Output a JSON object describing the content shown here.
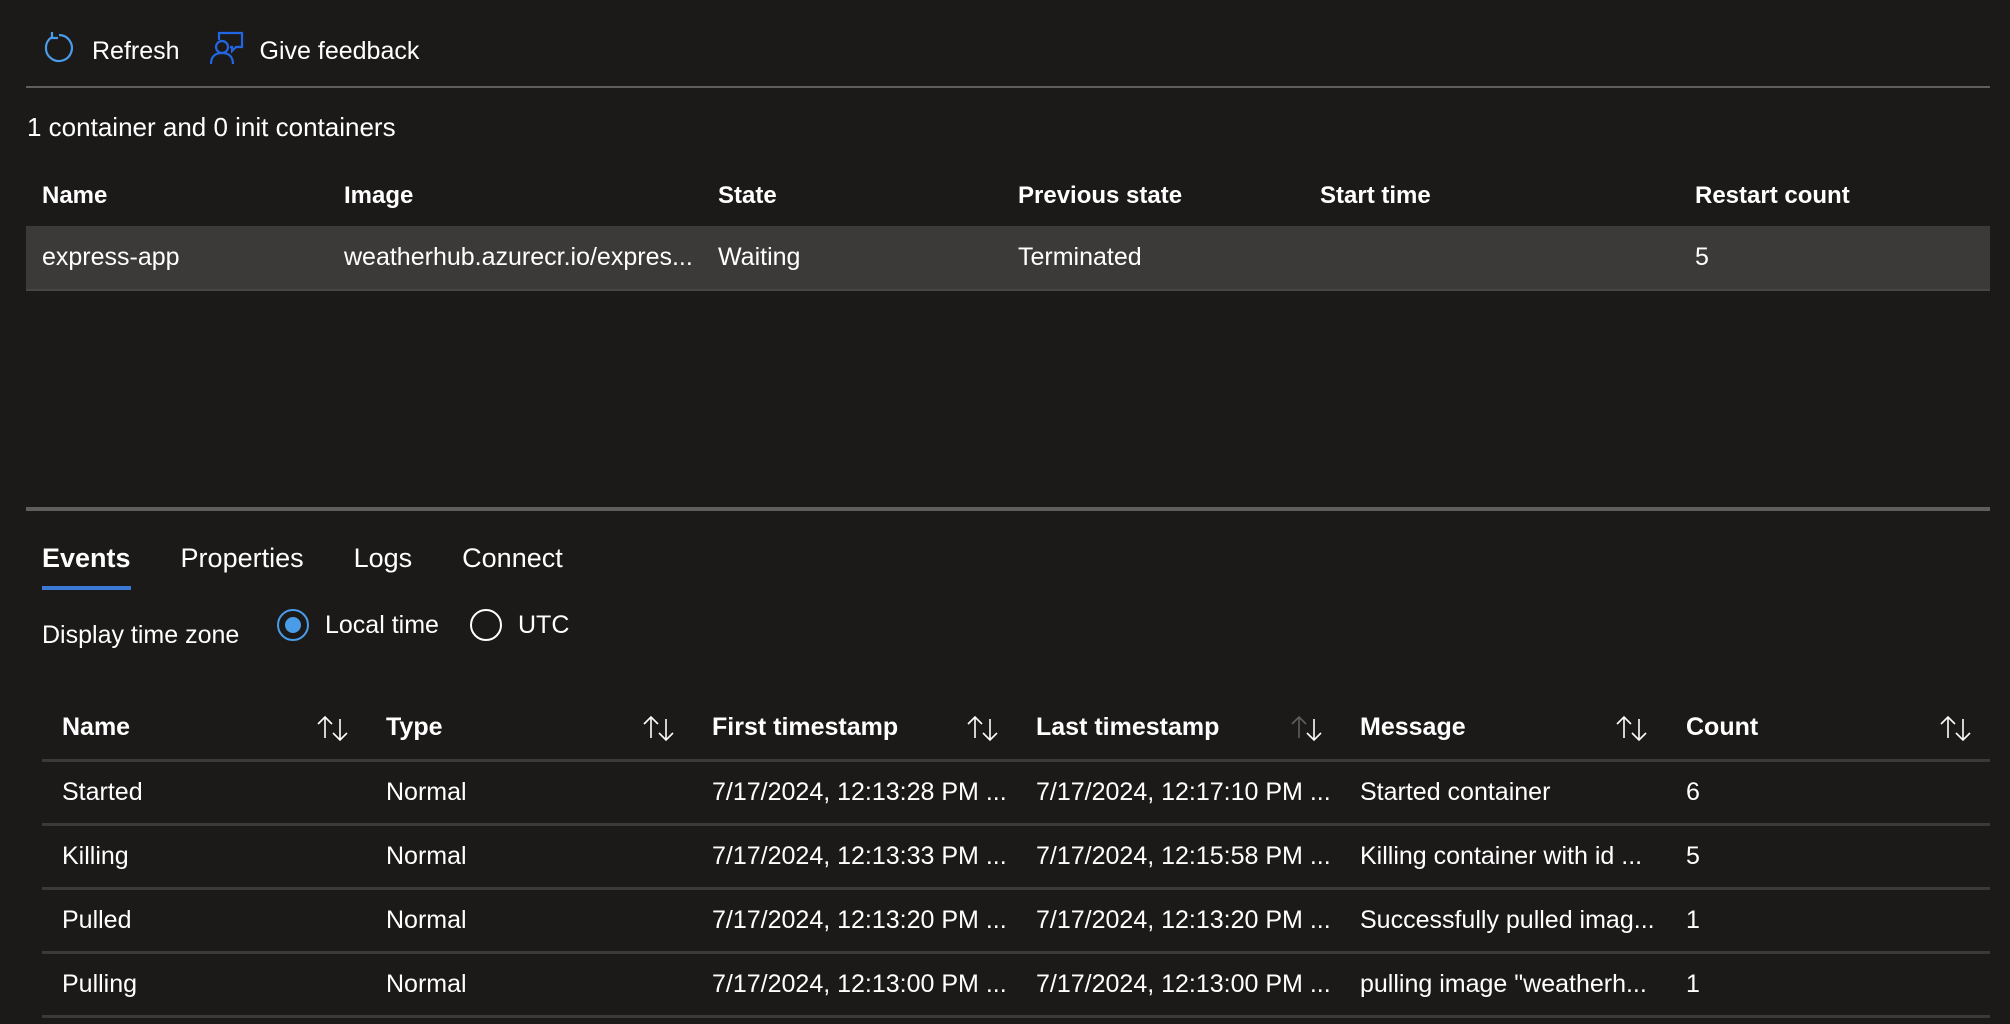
{
  "toolbar": {
    "refresh_label": "Refresh",
    "feedback_label": "Give feedback",
    "icon_refresh": "refresh-icon",
    "icon_feedback": "feedback-icon",
    "accent_refresh": "#4a9ce8",
    "accent_feedback": "#2266e3"
  },
  "containers": {
    "summary": "1 container and 0 init containers",
    "columns": [
      "Name",
      "Image",
      "State",
      "Previous state",
      "Start time",
      "Restart count"
    ],
    "rows": [
      {
        "name": "express-app",
        "image": "weatherhub.azurecr.io/expres...",
        "state": "Waiting",
        "previous_state": "Terminated",
        "start_time": "",
        "restart_count": "5"
      }
    ]
  },
  "tabs": [
    {
      "label": "Events",
      "active": true
    },
    {
      "label": "Properties",
      "active": false
    },
    {
      "label": "Logs",
      "active": false
    },
    {
      "label": "Connect",
      "active": false
    }
  ],
  "timezone": {
    "label": "Display time zone",
    "options": [
      {
        "label": "Local time",
        "checked": true
      },
      {
        "label": "UTC",
        "checked": false
      }
    ]
  },
  "events": {
    "columns": [
      {
        "label": "Name",
        "sort": "none"
      },
      {
        "label": "Type",
        "sort": "none"
      },
      {
        "label": "First timestamp",
        "sort": "none"
      },
      {
        "label": "Last timestamp",
        "sort": "descending"
      },
      {
        "label": "Message",
        "sort": "none"
      },
      {
        "label": "Count",
        "sort": "none"
      }
    ],
    "rows": [
      {
        "name": "Started",
        "type": "Normal",
        "first": "7/17/2024, 12:13:28 PM ...",
        "last": "7/17/2024, 12:17:10 PM ...",
        "message": "Started container",
        "count": "6"
      },
      {
        "name": "Killing",
        "type": "Normal",
        "first": "7/17/2024, 12:13:33 PM ...",
        "last": "7/17/2024, 12:15:58 PM ...",
        "message": "Killing container with id ...",
        "count": "5"
      },
      {
        "name": "Pulled",
        "type": "Normal",
        "first": "7/17/2024, 12:13:20 PM ...",
        "last": "7/17/2024, 12:13:20 PM ...",
        "message": "Successfully pulled imag...",
        "count": "1"
      },
      {
        "name": "Pulling",
        "type": "Normal",
        "first": "7/17/2024, 12:13:00 PM ...",
        "last": "7/17/2024, 12:13:00 PM ...",
        "message": "pulling image \"weatherh...",
        "count": "1"
      }
    ]
  }
}
